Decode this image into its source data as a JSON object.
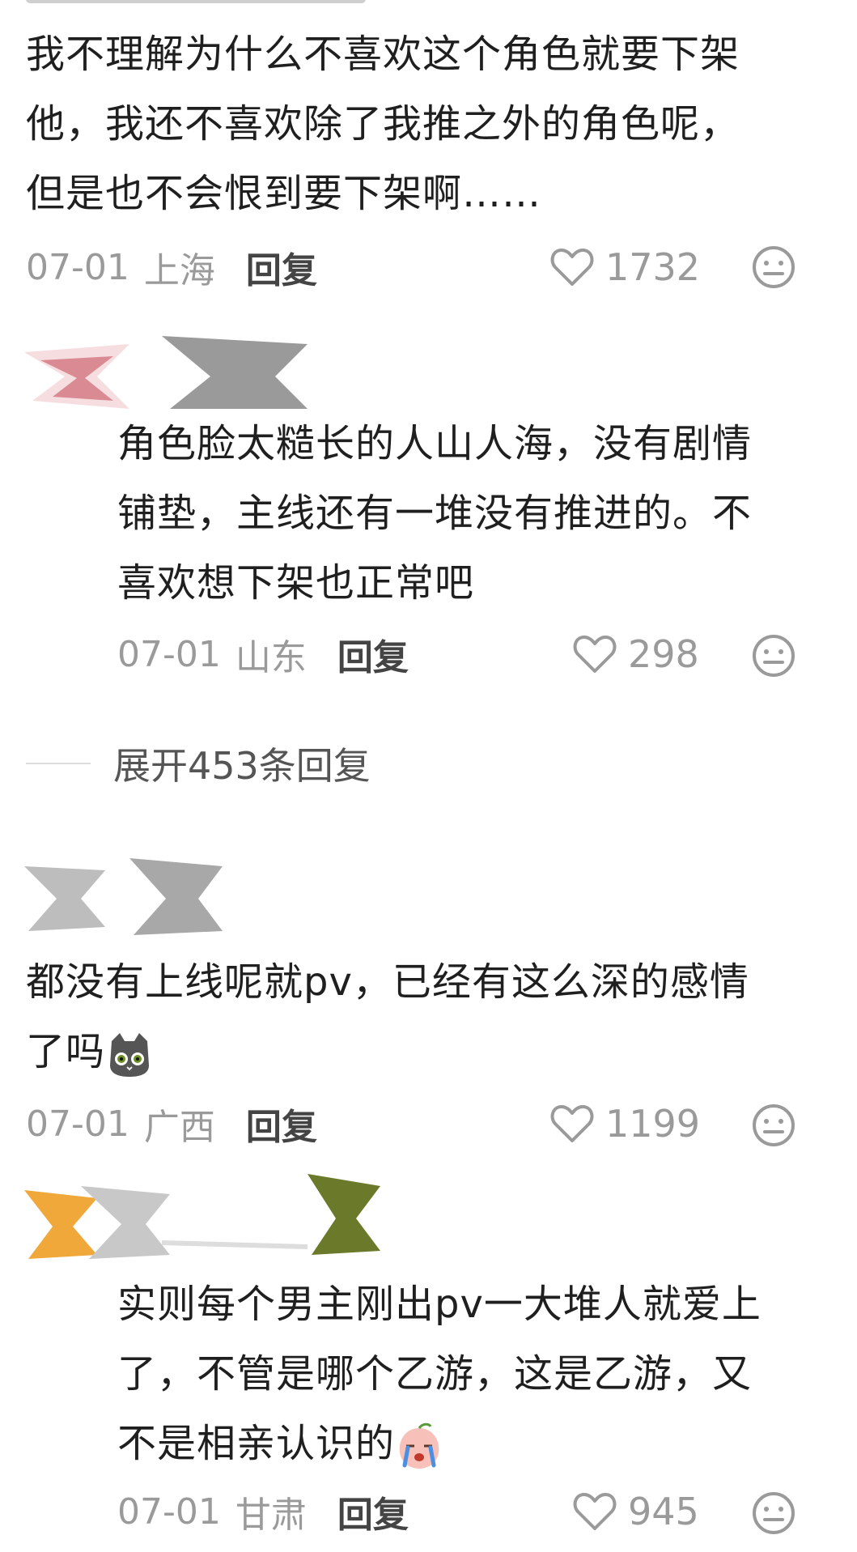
{
  "comments": [
    {
      "lines": [
        "我不理解为什么不喜欢这个角色就要下架",
        "他，我还不喜欢除了我推之外的角色呢，",
        "但是也不会恨到要下架啊……"
      ],
      "date": "07-01",
      "location": "上海",
      "reply_label": "回复",
      "likes": "1732"
    },
    {
      "lines": [
        "角色脸太糙长的人山人海，没有剧情",
        "铺垫，主线还有一堆没有推进的。不",
        "喜欢想下架也正常吧"
      ],
      "date": "07-01",
      "location": "山东",
      "reply_label": "回复",
      "likes": "298"
    },
    {
      "lines": [
        "都没有上线呢就pv，已经有这么深的感情",
        "了吗"
      ],
      "date": "07-01",
      "location": "广西",
      "reply_label": "回复",
      "likes": "1199"
    },
    {
      "lines": [
        "实则每个男主刚出pv一大堆人就爱上",
        "了，不管是哪个乙游，这是乙游，又",
        "不是相亲认识的"
      ],
      "date": "07-01",
      "location": "甘肃",
      "reply_label": "回复",
      "likes": "945"
    }
  ],
  "expand_replies": "展开453条回复",
  "icons": {
    "like": "heart-outline-icon",
    "reaction": "neutral-face-icon",
    "emoji_cat": "cat-face-emoji",
    "emoji_cry": "crying-peach-emoji"
  },
  "colors": {
    "text": "#1f1f1f",
    "meta": "#9a9a9a",
    "reply": "#444444"
  }
}
